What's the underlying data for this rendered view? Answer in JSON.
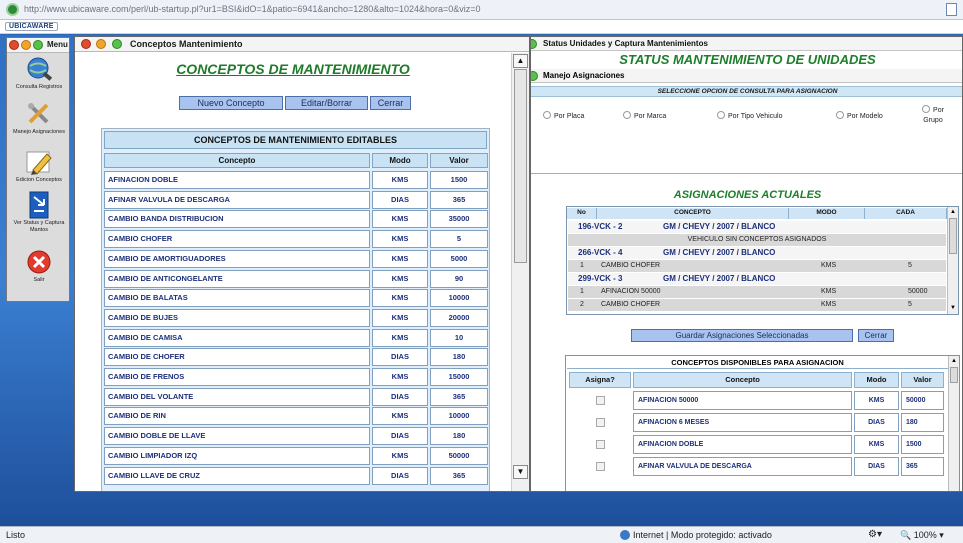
{
  "browser": {
    "url": "http://www.ubicaware.com/perl/ub-startup.pl?ur1=BSI&idO=1&patio=6941&ancho=1280&alto=1024&hora=0&viz=0",
    "app_logo": "UBICAWARE"
  },
  "menu_window": {
    "title": "Menu",
    "items": [
      {
        "label": "Consulta Registros",
        "icon": "globe-search-icon"
      },
      {
        "label": "Manejo Asignaciones",
        "icon": "tools-icon"
      },
      {
        "label": "Edicion Conceptos",
        "icon": "pencil-icon"
      },
      {
        "label": "Ver Status y Captura Mantos",
        "icon": "sign-arrow-icon"
      },
      {
        "label": "Salir",
        "icon": "exit-icon"
      }
    ]
  },
  "conceptos_window": {
    "window_title": "Conceptos Mantenimiento",
    "page_title": "CONCEPTOS DE MANTENIMIENTO",
    "buttons": [
      "Nuevo Concepto",
      "Editar/Borrar",
      "Cerrar"
    ],
    "table_title": "CONCEPTOS DE MANTENIMIENTO EDITABLES",
    "columns": [
      "Concepto",
      "Modo",
      "Valor"
    ],
    "rows": [
      [
        "AFINACION DOBLE",
        "KMS",
        "1500"
      ],
      [
        "AFINAR VALVULA DE DESCARGA",
        "DIAS",
        "365"
      ],
      [
        "CAMBIO BANDA DISTRIBUCION",
        "KMS",
        "35000"
      ],
      [
        "CAMBIO CHOFER",
        "KMS",
        "5"
      ],
      [
        "CAMBIO DE AMORTIGUADORES",
        "KMS",
        "5000"
      ],
      [
        "CAMBIO DE ANTICONGELANTE",
        "KMS",
        "90"
      ],
      [
        "CAMBIO DE BALATAS",
        "KMS",
        "10000"
      ],
      [
        "CAMBIO DE BUJES",
        "KMS",
        "20000"
      ],
      [
        "CAMBIO DE CAMISA",
        "KMS",
        "10"
      ],
      [
        "CAMBIO DE CHOFER",
        "DIAS",
        "180"
      ],
      [
        "CAMBIO DE FRENOS",
        "KMS",
        "15000"
      ],
      [
        "CAMBIO DEL VOLANTE",
        "DIAS",
        "365"
      ],
      [
        "CAMBIO DE RIN",
        "KMS",
        "10000"
      ],
      [
        "CAMBIO DOBLE DE LLAVE",
        "DIAS",
        "180"
      ],
      [
        "CAMBIO LIMPIADOR IZQ",
        "KMS",
        "50000"
      ],
      [
        "CAMBIO LLAVE DE CRUZ",
        "DIAS",
        "365"
      ]
    ]
  },
  "status_window": {
    "window_title": "Status Unidades y Captura Mantenimientos",
    "page_title": "STATUS MANTENIMIENTO DE UNIDADES",
    "sub_window_title": "Manejo Asignaciones",
    "consulta_bar": "SELECCIONE OPCION DE CONSULTA PARA ASIGNACION",
    "radio_options": [
      "Por Placa",
      "Por Marca",
      "Por Tipo Vehiculo",
      "Por Modelo",
      "Por Grupo"
    ],
    "asignaciones_title": "ASIGNACIONES ACTUALES",
    "asig_columns": [
      "No",
      "CONCEPTO",
      "MODO",
      "CADA"
    ],
    "asignaciones": [
      {
        "vehicle": "196-VCK - 2",
        "desc": "GM / CHEVY / 2007 / BLANCO",
        "note": "VEHICULO SIN CONCEPTOS ASIGNADOS",
        "items": []
      },
      {
        "vehicle": "266-VCK - 4",
        "desc": "GM / CHEVY / 2007 / BLANCO",
        "note": "",
        "items": [
          [
            "1",
            "CAMBIO CHOFER",
            "KMS",
            "5"
          ]
        ]
      },
      {
        "vehicle": "299-VCK - 3",
        "desc": "GM / CHEVY / 2007 / BLANCO",
        "note": "",
        "items": [
          [
            "1",
            "AFINACION 50000",
            "KMS",
            "50000"
          ],
          [
            "2",
            "CAMBIO CHOFER",
            "KMS",
            "5"
          ]
        ]
      }
    ],
    "guardar_button": "Guardar Asignaciones Seleccionadas",
    "cerrar_button": "Cerrar",
    "disponibles_title": "CONCEPTOS DISPONIBLES PARA ASIGNACION",
    "disp_columns": [
      "Asigna?",
      "Concepto",
      "Modo",
      "Valor"
    ],
    "disponibles": [
      [
        "AFINACION 50000",
        "KMS",
        "50000"
      ],
      [
        "AFINACION 6 MESES",
        "DIAS",
        "180"
      ],
      [
        "AFINACION DOBLE",
        "KMS",
        "1500"
      ],
      [
        "AFINAR VALVULA DE DESCARGA",
        "DIAS",
        "365"
      ]
    ]
  },
  "statusbar": {
    "left": "Listo",
    "zone": "Internet | Modo protegido: activado",
    "zoom": "100%"
  }
}
